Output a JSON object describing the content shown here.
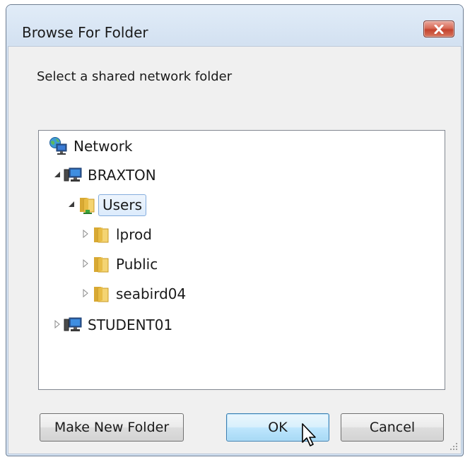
{
  "window": {
    "title": "Browse For Folder",
    "close_icon": "close-icon"
  },
  "instruction": "Select a shared network folder",
  "tree": {
    "network": {
      "label": "Network",
      "icon": "network-globe-icon"
    },
    "braxton": {
      "label": "BRAXTON",
      "icon": "computer-icon",
      "expanded": true
    },
    "users": {
      "label": "Users",
      "icon": "shared-folder-icon",
      "expanded": true,
      "selected": true
    },
    "lprod": {
      "label": "lprod",
      "icon": "folder-icon",
      "expanded": false
    },
    "public": {
      "label": "Public",
      "icon": "folder-icon",
      "expanded": false
    },
    "seabird04": {
      "label": "seabird04",
      "icon": "folder-icon",
      "expanded": false
    },
    "student01": {
      "label": "STUDENT01",
      "icon": "computer-icon",
      "expanded": false
    }
  },
  "buttons": {
    "make_new_folder": "Make New Folder",
    "ok": "OK",
    "cancel": "Cancel"
  },
  "colors": {
    "selection_fill": "#dcebfc",
    "selection_border": "#84acdd",
    "default_button": "#bee6fd"
  }
}
